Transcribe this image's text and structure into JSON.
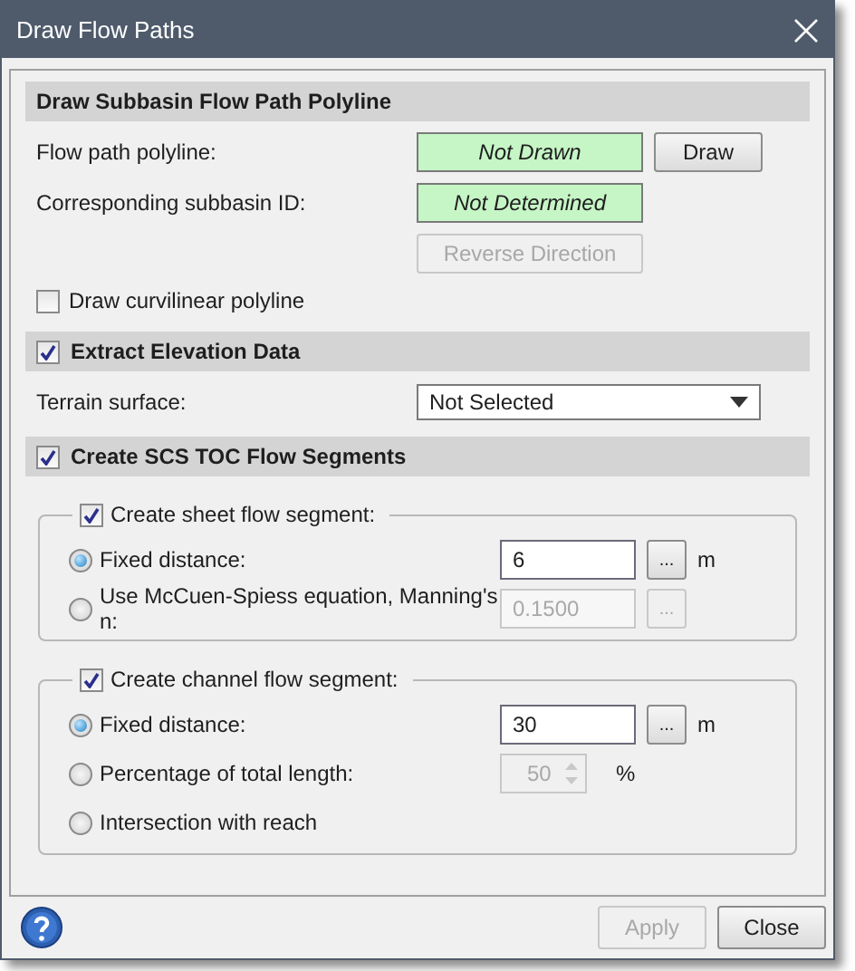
{
  "window": {
    "title": "Draw Flow Paths"
  },
  "polyline_section": {
    "title": "Draw Subbasin Flow Path Polyline",
    "rows": [
      {
        "label": "Flow path polyline:",
        "status": "Not Drawn",
        "button": "Draw"
      },
      {
        "label": "Corresponding subbasin ID:",
        "status": "Not Determined"
      }
    ],
    "reverse_button": {
      "label": "Reverse Direction",
      "disabled": true
    },
    "curvilinear": {
      "label": "Draw curvilinear polyline",
      "checked": false
    }
  },
  "elevation_section": {
    "title": "Extract Elevation Data",
    "checked": true,
    "terrain": {
      "label": "Terrain surface:",
      "value": "Not Selected"
    }
  },
  "toc_section": {
    "title": "Create SCS TOC Flow Segments",
    "checked": true,
    "groups": [
      {
        "label": "Create sheet flow segment:",
        "checked": true,
        "options": [
          {
            "kind": "text",
            "label": "Fixed distance:",
            "selected": true,
            "value": "6",
            "button": "...",
            "unit": "m",
            "disabled": false
          },
          {
            "kind": "text",
            "label": "Use McCuen-Spiess equation, Manning's n:",
            "selected": false,
            "value": "0.1500",
            "button": "...",
            "disabled": true
          }
        ]
      },
      {
        "label": "Create channel flow segment:",
        "checked": true,
        "options": [
          {
            "kind": "text",
            "label": "Fixed distance:",
            "selected": true,
            "value": "30",
            "button": "...",
            "unit": "m",
            "disabled": false
          },
          {
            "kind": "spinner",
            "label": "Percentage of total length:",
            "selected": false,
            "value": "50",
            "unit": "%",
            "disabled": true
          },
          {
            "kind": "plain",
            "label": "Intersection with reach",
            "selected": false
          }
        ]
      }
    ]
  },
  "footer": {
    "buttons": [
      {
        "label": "Apply",
        "disabled": true
      },
      {
        "label": "Close",
        "disabled": false
      }
    ]
  }
}
